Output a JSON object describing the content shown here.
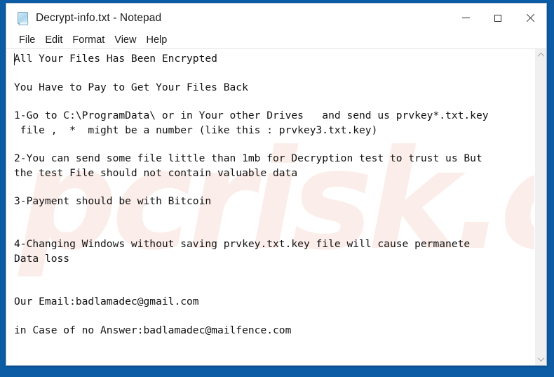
{
  "window": {
    "title": "Decrypt-info.txt - Notepad",
    "app_icon": "notepad-document-icon",
    "minimize_label": "Minimize",
    "maximize_label": "Maximize",
    "close_label": "Close"
  },
  "menu": {
    "items": [
      {
        "label": "File"
      },
      {
        "label": "Edit"
      },
      {
        "label": "Format"
      },
      {
        "label": "View"
      },
      {
        "label": "Help"
      }
    ]
  },
  "editor": {
    "body": "All Your Files Has Been Encrypted\n\nYou Have to Pay to Get Your Files Back\n\n1-Go to C:\\ProgramData\\ or in Your other Drives   and send us prvkey*.txt.key\n file ,  *  might be a number (like this : prvkey3.txt.key)\n\n2-You can send some file little than 1mb for Decryption test to trust us But\nthe test File should not contain valuable data\n\n3-Payment should be with Bitcoin\n\n\n4-Changing Windows without saving prvkey.txt.key file will cause permanete\nData loss\n\n\nOur Email:badlamadec@gmail.com\n\nin Case of no Answer:badlamadec@mailfence.com\n",
    "lines": [
      "All Your Files Has Been Encrypted",
      "",
      "You Have to Pay to Get Your Files Back",
      "",
      "1-Go to C:\\ProgramData\\ or in Your other Drives   and send us prvkey*.txt.key",
      " file ,  *  might be a number (like this : prvkey3.txt.key)",
      "",
      "2-You can send some file little than 1mb for Decryption test to trust us But",
      "the test File should not contain valuable data",
      "",
      "3-Payment should be with Bitcoin",
      "",
      "",
      "4-Changing Windows without saving prvkey.txt.key file will cause permanete",
      "Data loss",
      "",
      "",
      "Our Email:badlamadec@gmail.com",
      "",
      "in Case of no Answer:badlamadec@mailfence.com"
    ],
    "contact_email_primary": "badlamadec@gmail.com",
    "contact_email_secondary": "badlamadec@mailfence.com"
  },
  "watermark": {
    "text": "pcrisk.com"
  },
  "scrollbar": {
    "up_arrow": "scroll-up-icon",
    "down_arrow": "scroll-down-icon"
  },
  "colors": {
    "desktop_blue": "#0b5ca5",
    "window_bg": "#ffffff",
    "text": "#121212",
    "scrollbar_track": "#f0f0f0",
    "watermark": "#fbeeea"
  }
}
